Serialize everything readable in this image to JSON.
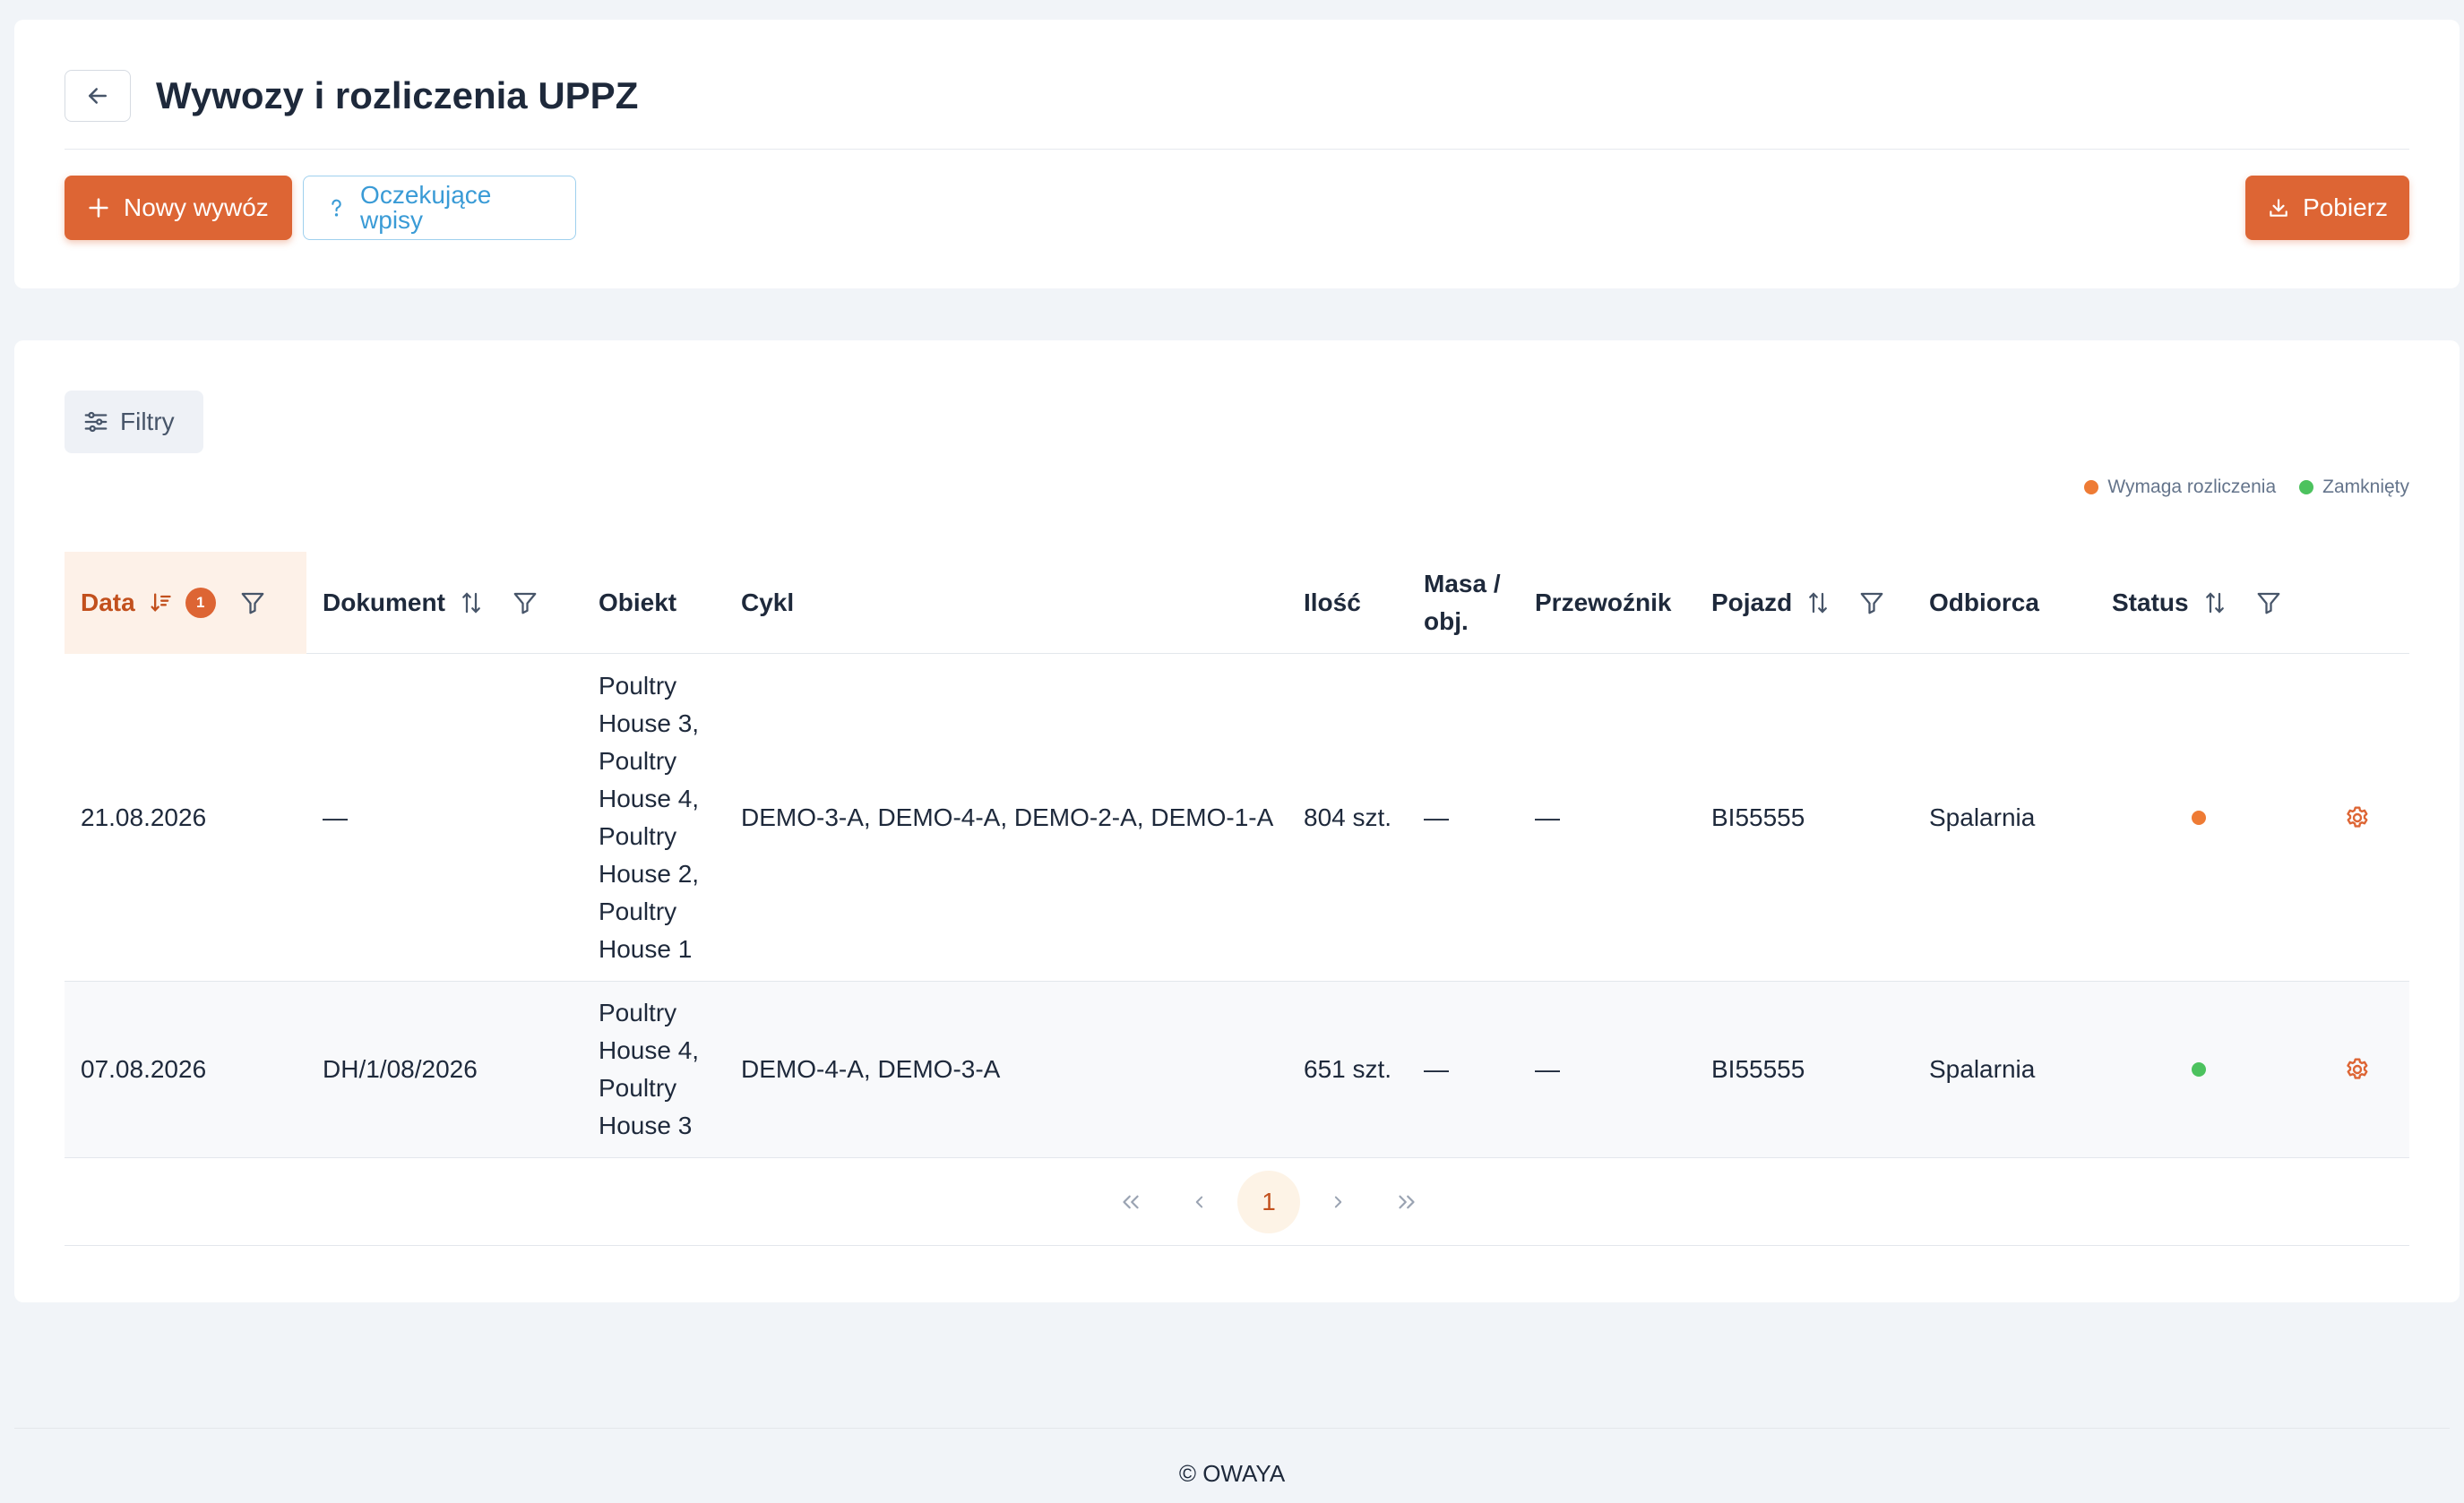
{
  "header": {
    "title": "Wywozy i rozliczenia UPPZ",
    "new_button": "Nowy wywóz",
    "pending_button": "Oczekujące wpisy",
    "download_button": "Pobierz"
  },
  "filters": {
    "label": "Filtry"
  },
  "legend": [
    {
      "label": "Wymaga rozliczenia",
      "color": "#ee7b35"
    },
    {
      "label": "Zamknięty",
      "color": "#4cc25e"
    }
  ],
  "table": {
    "columns": {
      "data": "Data",
      "data_sort_badge": "1",
      "dokument": "Dokument",
      "obiekt": "Obiekt",
      "cykl": "Cykl",
      "ilosc": "Ilość",
      "masa": "Masa /\nobj.",
      "przewoznik": "Przewoźnik",
      "pojazd": "Pojazd",
      "odbiorca": "Odbiorca",
      "status": "Status"
    },
    "rows": [
      {
        "data": "21.08.2026",
        "dokument": "—",
        "obiekt": "Poultry\nHouse 3,\nPoultry\nHouse 4,\nPoultry\nHouse 2,\nPoultry\nHouse 1",
        "cykl": "DEMO-3-A, DEMO-4-A, DEMO-2-A, DEMO-1-A",
        "ilosc": "804 szt.",
        "masa": "—",
        "przewoznik": "—",
        "pojazd": "BI55555",
        "odbiorca": "Spalarnia",
        "status_color": "#ee7b35"
      },
      {
        "data": "07.08.2026",
        "dokument": "DH/1/08/2026",
        "obiekt": "Poultry\nHouse 4,\nPoultry\nHouse 3",
        "cykl": "DEMO-4-A, DEMO-3-A",
        "ilosc": "651 szt.",
        "masa": "—",
        "przewoznik": "—",
        "pojazd": "BI55555",
        "odbiorca": "Spalarnia",
        "status_color": "#4cc25e"
      }
    ]
  },
  "pagination": {
    "current_page": "1"
  },
  "footer": {
    "copyright": "© OWAYA"
  }
}
